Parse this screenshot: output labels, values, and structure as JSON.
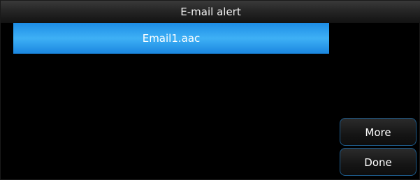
{
  "dialog": {
    "title": "E-mail alert"
  },
  "list": {
    "items": [
      {
        "label": "Email1.aac",
        "selected": true
      }
    ]
  },
  "buttons": {
    "more_label": "More",
    "done_label": "Done"
  },
  "colors": {
    "background": "#000000",
    "selection": "#3eb0f5",
    "button_border": "#1d5a8a"
  }
}
